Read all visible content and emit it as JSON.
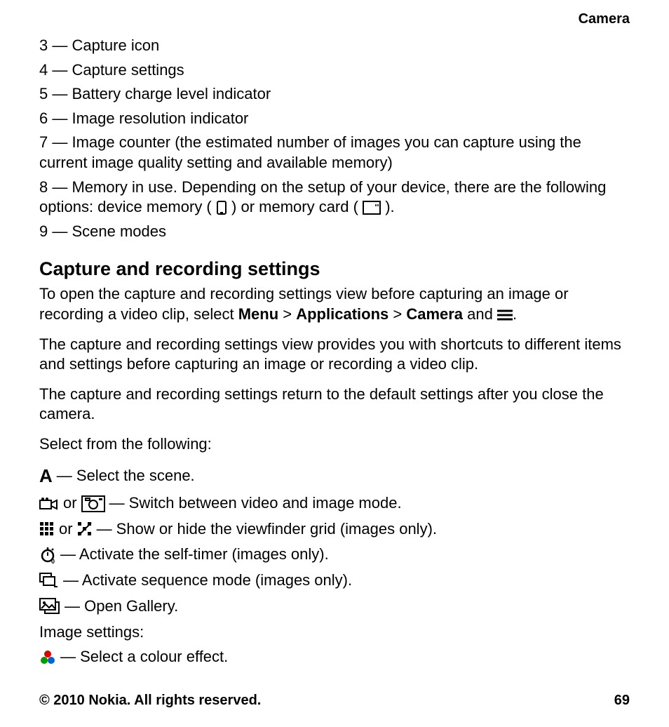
{
  "header": {
    "section": "Camera"
  },
  "numbered": {
    "n3": "3 — Capture icon",
    "n4": "4 — Capture settings",
    "n5": "5 — Battery charge level indicator",
    "n6": "6 — Image resolution indicator",
    "n7": "7 — Image counter (the estimated number of images you can capture using the current image quality setting and available memory)",
    "n8a": "8 — Memory in use. Depending on the setup of your device, there are the following options: device memory (",
    "n8b": ") or memory card (",
    "n8c": ").",
    "n9": "9 — Scene modes"
  },
  "heading": "Capture and recording settings",
  "intro": {
    "p1a": "To open the capture and recording settings view before capturing an image or recording a video clip, select ",
    "menu": "Menu",
    "gt1": "  >  ",
    "apps": "Applications",
    "gt2": "  >  ",
    "camera": "Camera",
    "p1b": " and ",
    "p1c": ".",
    "p2": "The capture and recording settings view provides you with shortcuts to different items and settings before capturing an image or recording a video clip.",
    "p3": "The capture and recording settings return to the default settings after you close the camera.",
    "p4": "Select from the following:"
  },
  "options": {
    "scene": " —  Select the scene.",
    "or1": " or ",
    "switch": " —  Switch between video and image mode.",
    "or2": " or ",
    "grid": " —  Show or hide the viewfinder grid (images only).",
    "timer": " —  Activate the self-timer (images only).",
    "sequence": " —  Activate sequence mode (images only).",
    "gallery": "  —  Open Gallery."
  },
  "imgset": {
    "head": "Image settings:",
    "colour": " —  Select a colour effect."
  },
  "footer": {
    "copyright": "© 2010 Nokia. All rights reserved.",
    "page": "69"
  }
}
